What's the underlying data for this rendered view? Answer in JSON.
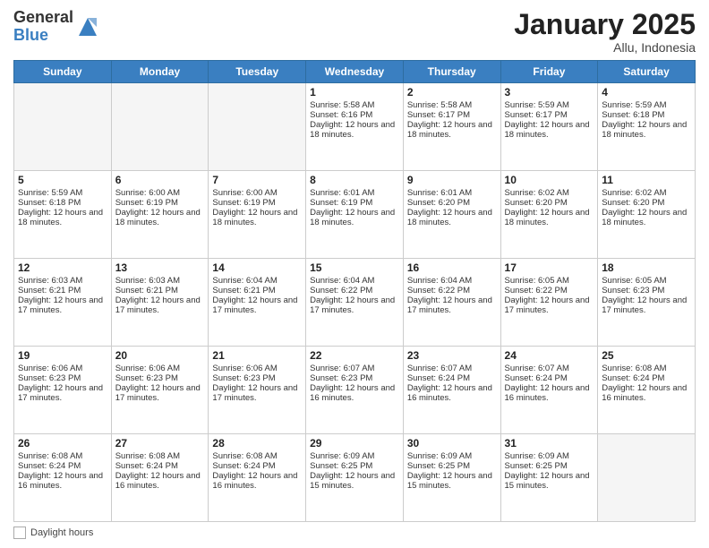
{
  "header": {
    "logo_general": "General",
    "logo_blue": "Blue",
    "month_title": "January 2025",
    "location": "Allu, Indonesia"
  },
  "days_of_week": [
    "Sunday",
    "Monday",
    "Tuesday",
    "Wednesday",
    "Thursday",
    "Friday",
    "Saturday"
  ],
  "footer_label": "Daylight hours",
  "weeks": [
    [
      {
        "day": "",
        "content": ""
      },
      {
        "day": "",
        "content": ""
      },
      {
        "day": "",
        "content": ""
      },
      {
        "day": "1",
        "content": "Sunrise: 5:58 AM\nSunset: 6:16 PM\nDaylight: 12 hours and 18 minutes."
      },
      {
        "day": "2",
        "content": "Sunrise: 5:58 AM\nSunset: 6:17 PM\nDaylight: 12 hours and 18 minutes."
      },
      {
        "day": "3",
        "content": "Sunrise: 5:59 AM\nSunset: 6:17 PM\nDaylight: 12 hours and 18 minutes."
      },
      {
        "day": "4",
        "content": "Sunrise: 5:59 AM\nSunset: 6:18 PM\nDaylight: 12 hours and 18 minutes."
      }
    ],
    [
      {
        "day": "5",
        "content": "Sunrise: 5:59 AM\nSunset: 6:18 PM\nDaylight: 12 hours and 18 minutes."
      },
      {
        "day": "6",
        "content": "Sunrise: 6:00 AM\nSunset: 6:19 PM\nDaylight: 12 hours and 18 minutes."
      },
      {
        "day": "7",
        "content": "Sunrise: 6:00 AM\nSunset: 6:19 PM\nDaylight: 12 hours and 18 minutes."
      },
      {
        "day": "8",
        "content": "Sunrise: 6:01 AM\nSunset: 6:19 PM\nDaylight: 12 hours and 18 minutes."
      },
      {
        "day": "9",
        "content": "Sunrise: 6:01 AM\nSunset: 6:20 PM\nDaylight: 12 hours and 18 minutes."
      },
      {
        "day": "10",
        "content": "Sunrise: 6:02 AM\nSunset: 6:20 PM\nDaylight: 12 hours and 18 minutes."
      },
      {
        "day": "11",
        "content": "Sunrise: 6:02 AM\nSunset: 6:20 PM\nDaylight: 12 hours and 18 minutes."
      }
    ],
    [
      {
        "day": "12",
        "content": "Sunrise: 6:03 AM\nSunset: 6:21 PM\nDaylight: 12 hours and 17 minutes."
      },
      {
        "day": "13",
        "content": "Sunrise: 6:03 AM\nSunset: 6:21 PM\nDaylight: 12 hours and 17 minutes."
      },
      {
        "day": "14",
        "content": "Sunrise: 6:04 AM\nSunset: 6:21 PM\nDaylight: 12 hours and 17 minutes."
      },
      {
        "day": "15",
        "content": "Sunrise: 6:04 AM\nSunset: 6:22 PM\nDaylight: 12 hours and 17 minutes."
      },
      {
        "day": "16",
        "content": "Sunrise: 6:04 AM\nSunset: 6:22 PM\nDaylight: 12 hours and 17 minutes."
      },
      {
        "day": "17",
        "content": "Sunrise: 6:05 AM\nSunset: 6:22 PM\nDaylight: 12 hours and 17 minutes."
      },
      {
        "day": "18",
        "content": "Sunrise: 6:05 AM\nSunset: 6:23 PM\nDaylight: 12 hours and 17 minutes."
      }
    ],
    [
      {
        "day": "19",
        "content": "Sunrise: 6:06 AM\nSunset: 6:23 PM\nDaylight: 12 hours and 17 minutes."
      },
      {
        "day": "20",
        "content": "Sunrise: 6:06 AM\nSunset: 6:23 PM\nDaylight: 12 hours and 17 minutes."
      },
      {
        "day": "21",
        "content": "Sunrise: 6:06 AM\nSunset: 6:23 PM\nDaylight: 12 hours and 17 minutes."
      },
      {
        "day": "22",
        "content": "Sunrise: 6:07 AM\nSunset: 6:23 PM\nDaylight: 12 hours and 16 minutes."
      },
      {
        "day": "23",
        "content": "Sunrise: 6:07 AM\nSunset: 6:24 PM\nDaylight: 12 hours and 16 minutes."
      },
      {
        "day": "24",
        "content": "Sunrise: 6:07 AM\nSunset: 6:24 PM\nDaylight: 12 hours and 16 minutes."
      },
      {
        "day": "25",
        "content": "Sunrise: 6:08 AM\nSunset: 6:24 PM\nDaylight: 12 hours and 16 minutes."
      }
    ],
    [
      {
        "day": "26",
        "content": "Sunrise: 6:08 AM\nSunset: 6:24 PM\nDaylight: 12 hours and 16 minutes."
      },
      {
        "day": "27",
        "content": "Sunrise: 6:08 AM\nSunset: 6:24 PM\nDaylight: 12 hours and 16 minutes."
      },
      {
        "day": "28",
        "content": "Sunrise: 6:08 AM\nSunset: 6:24 PM\nDaylight: 12 hours and 16 minutes."
      },
      {
        "day": "29",
        "content": "Sunrise: 6:09 AM\nSunset: 6:25 PM\nDaylight: 12 hours and 15 minutes."
      },
      {
        "day": "30",
        "content": "Sunrise: 6:09 AM\nSunset: 6:25 PM\nDaylight: 12 hours and 15 minutes."
      },
      {
        "day": "31",
        "content": "Sunrise: 6:09 AM\nSunset: 6:25 PM\nDaylight: 12 hours and 15 minutes."
      },
      {
        "day": "",
        "content": ""
      }
    ]
  ]
}
